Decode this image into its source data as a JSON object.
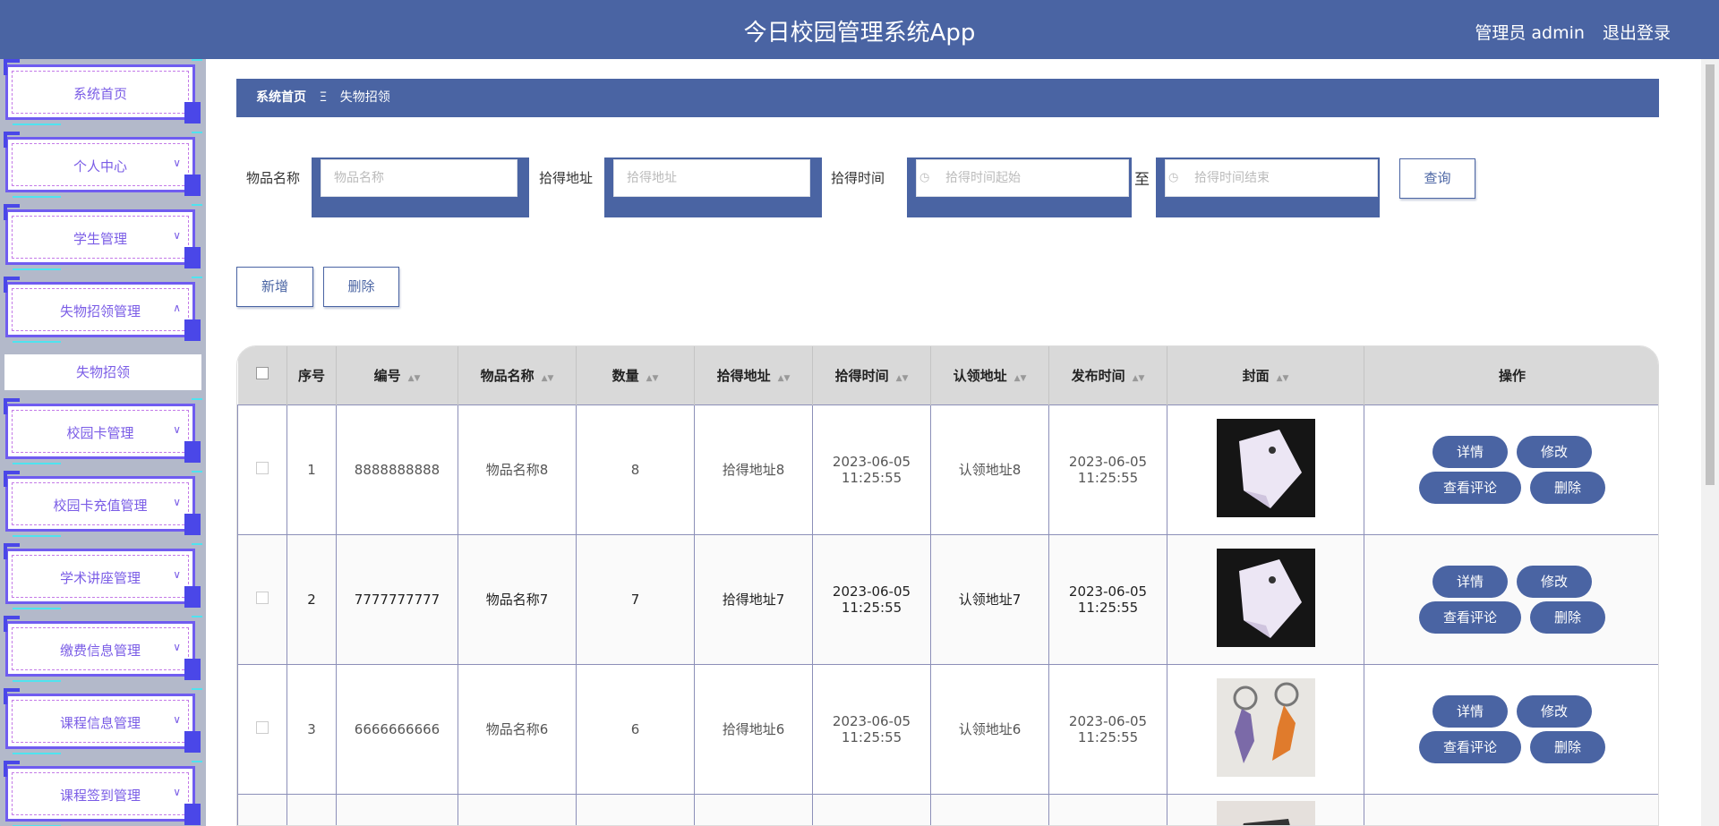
{
  "header": {
    "title": "今日校园管理系统App",
    "user": "管理员 admin",
    "logout": "退出登录"
  },
  "sidebar": {
    "items": [
      {
        "label": "系统首页",
        "chevron": ""
      },
      {
        "label": "个人中心",
        "chevron": "∨"
      },
      {
        "label": "学生管理",
        "chevron": "∨"
      },
      {
        "label": "失物招领管理",
        "chevron": "∧"
      },
      {
        "label": "校园卡管理",
        "chevron": "∨"
      },
      {
        "label": "校园卡充值管理",
        "chevron": "∨"
      },
      {
        "label": "学术讲座管理",
        "chevron": "∨"
      },
      {
        "label": "缴费信息管理",
        "chevron": "∨"
      },
      {
        "label": "课程信息管理",
        "chevron": "∨"
      },
      {
        "label": "课程签到管理",
        "chevron": "∨"
      }
    ],
    "sub_item": "失物招领"
  },
  "breadcrumb": {
    "home": "系统首页",
    "separator": "Ξ",
    "current": "失物招领"
  },
  "search": {
    "name_label": "物品名称",
    "name_placeholder": "物品名称",
    "addr_label": "拾得地址",
    "addr_placeholder": "拾得地址",
    "time_label": "拾得时间",
    "time_start_placeholder": "拾得时间起始",
    "to": "至",
    "time_end_placeholder": "拾得时间结束",
    "query": "查询"
  },
  "actions": {
    "add": "新增",
    "delete": "删除"
  },
  "table": {
    "headers": [
      "序号",
      "编号",
      "物品名称",
      "数量",
      "拾得地址",
      "拾得时间",
      "认领地址",
      "发布时间",
      "封面",
      "操作"
    ],
    "rows": [
      {
        "index": "1",
        "code": "8888888888",
        "name": "物品名称8",
        "qty": "8",
        "addr": "拾得地址8",
        "time": "2023-06-05 11:25:55",
        "claim": "认领地址8",
        "pub": "2023-06-05 11:25:55"
      },
      {
        "index": "2",
        "code": "7777777777",
        "name": "物品名称7",
        "qty": "7",
        "addr": "拾得地址7",
        "time": "2023-06-05 11:25:55",
        "claim": "认领地址7",
        "pub": "2023-06-05 11:25:55"
      },
      {
        "index": "3",
        "code": "6666666666",
        "name": "物品名称6",
        "qty": "6",
        "addr": "拾得地址6",
        "time": "2023-06-05 11:25:55",
        "claim": "认领地址6",
        "pub": "2023-06-05 11:25:55"
      }
    ],
    "ops": {
      "detail": "详情",
      "edit": "修改",
      "comments": "查看评论",
      "delete": "删除"
    }
  },
  "colors": {
    "primary": "#4a64a3",
    "menu_text": "#7a5ce6",
    "menu_border": "#6f5cf0",
    "accent_cyan": "#4fe3ef"
  }
}
